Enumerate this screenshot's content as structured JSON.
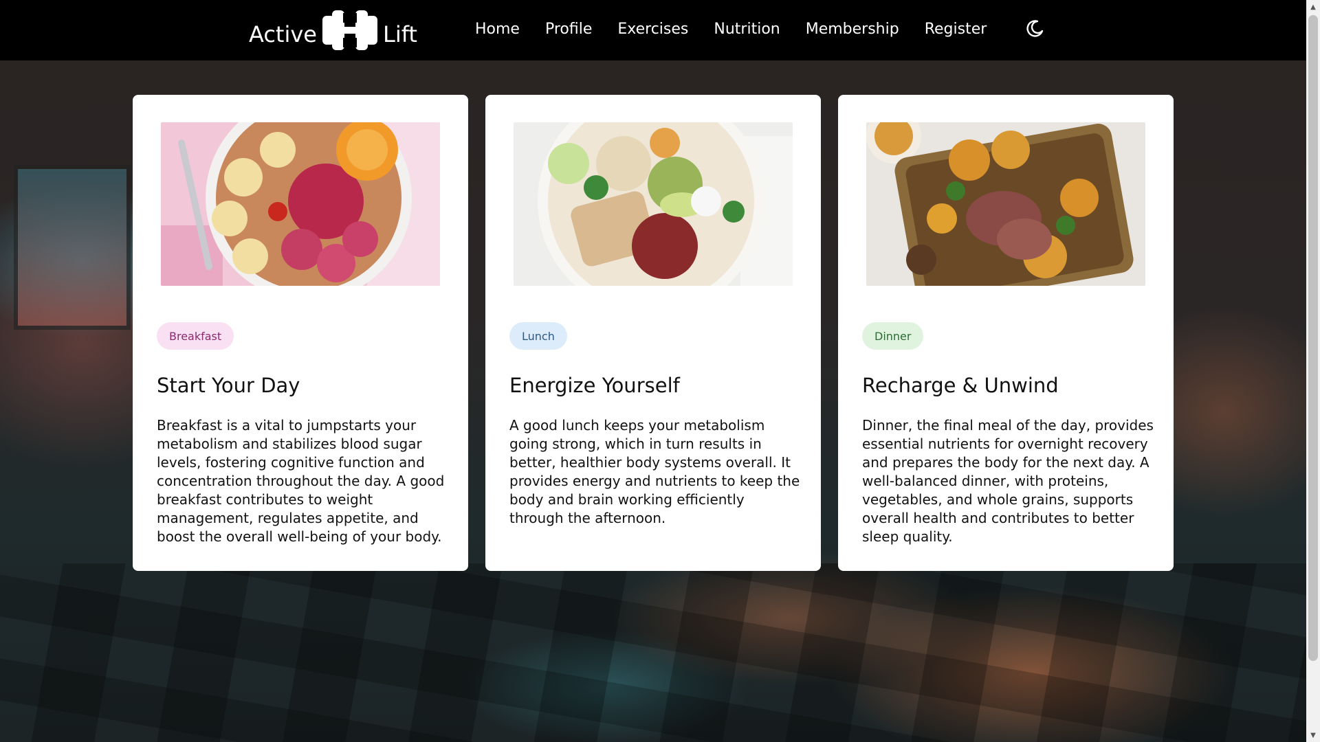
{
  "header": {
    "logo_left": "Active",
    "logo_right": "Lift",
    "nav": [
      "Home",
      "Profile",
      "Exercises",
      "Nutrition",
      "Membership",
      "Register"
    ],
    "theme_icon": "moon-icon"
  },
  "cards": [
    {
      "badge": "Breakfast",
      "badge_bg": "#f9e1f3",
      "badge_color": "#8a2a6f",
      "title": "Start Your Day",
      "text": "Breakfast is a vital to jumpstarts your metabolism and stabilizes blood sugar levels, fostering cognitive function and concentration throughout the day. A good breakfast contributes to weight management, regulates appetite, and boost the overall well-being of your body."
    },
    {
      "badge": "Lunch",
      "badge_bg": "#dcecfb",
      "badge_color": "#2b5a86",
      "title": "Energize Yourself",
      "text": "A good lunch keeps your metabolism going strong, which in turn results in better, healthier body systems overall. It provides energy and nutrients to keep the body and brain working efficiently through the afternoon."
    },
    {
      "badge": "Dinner",
      "badge_bg": "#dff3df",
      "badge_color": "#2e6a36",
      "title": "Recharge & Unwind",
      "text": "Dinner, the final meal of the day, provides essential nutrients for overnight recovery and prepares the body for the next day. A well-balanced dinner, with proteins, vegetables, and whole grains, supports overall health and contributes to better sleep quality."
    }
  ]
}
